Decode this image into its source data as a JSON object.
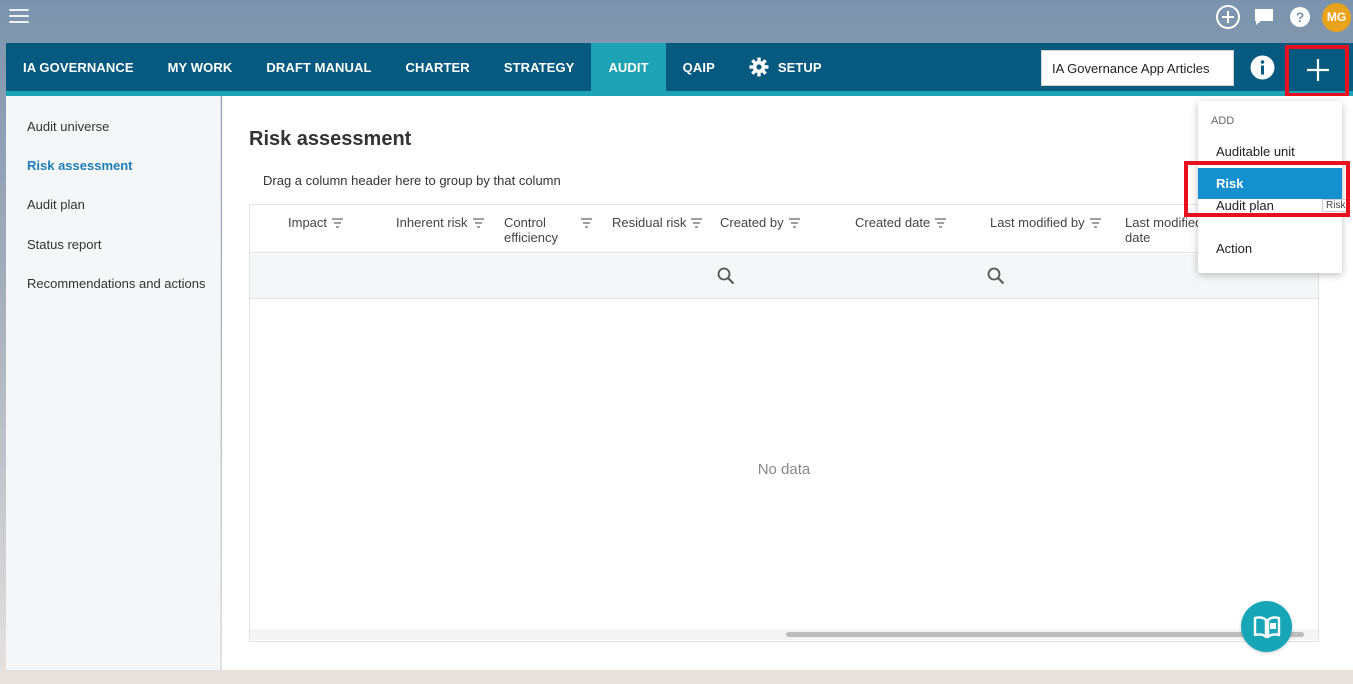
{
  "topbar": {
    "icons": [
      "add-circle-icon",
      "chat-icon",
      "help-icon"
    ],
    "avatar_initials": "MG",
    "avatar_color": "#e8a21b"
  },
  "nav": {
    "items": [
      {
        "label": "IA GOVERNANCE",
        "active": false
      },
      {
        "label": "MY WORK",
        "active": false
      },
      {
        "label": "DRAFT MANUAL",
        "active": false
      },
      {
        "label": "CHARTER",
        "active": false
      },
      {
        "label": "STRATEGY",
        "active": false
      },
      {
        "label": "AUDIT",
        "active": true
      },
      {
        "label": "QAIP",
        "active": false
      },
      {
        "label": "SETUP",
        "active": false,
        "icon": "gear-icon"
      }
    ],
    "search_value": "IA Governance App Articles",
    "colors": {
      "bar": "#06597f",
      "active": "#1ea2b5"
    }
  },
  "sidebar": {
    "items": [
      {
        "label": "Audit universe",
        "active": false
      },
      {
        "label": "Risk assessment",
        "active": true
      },
      {
        "label": "Audit plan",
        "active": false
      },
      {
        "label": "Status report",
        "active": false
      },
      {
        "label": "Recommendations and actions",
        "active": false
      }
    ]
  },
  "main": {
    "title": "Risk assessment",
    "group_hint": "Drag a column header here to group by that column",
    "columns": [
      {
        "label": "Impact",
        "line2": ""
      },
      {
        "label": "Inherent risk",
        "line2": ""
      },
      {
        "label": "Control",
        "line2": "efficiency"
      },
      {
        "label": "Residual risk",
        "line2": ""
      },
      {
        "label": "Created by",
        "line2": ""
      },
      {
        "label": "Created date",
        "line2": ""
      },
      {
        "label": "Last modified by",
        "line2": ""
      },
      {
        "label": "Last modified",
        "line2": "date"
      }
    ],
    "empty_text": "No data"
  },
  "add_menu": {
    "heading": "ADD",
    "items": [
      {
        "label": "Auditable unit",
        "highlighted": false
      },
      {
        "label": "Risk",
        "highlighted": true
      },
      {
        "label": "Audit plan",
        "highlighted": false
      },
      {
        "label": "Action",
        "highlighted": false
      }
    ],
    "tooltip": "Risk",
    "highlight_color": "#1590cf",
    "annotation_color": "#e8101e"
  }
}
